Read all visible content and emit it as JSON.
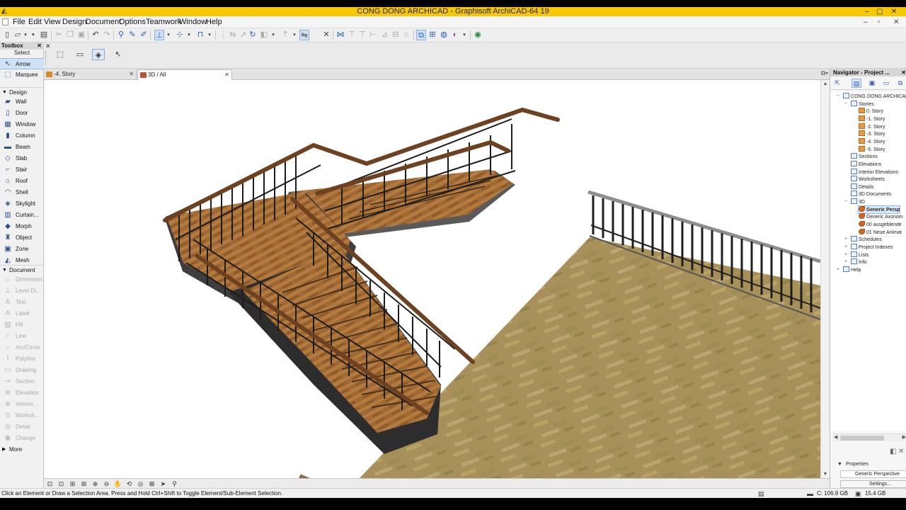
{
  "window": {
    "title": "CONG DONG ARCHICAD - Graphisoft ArchiCAD-64 19",
    "controls": [
      "–",
      "▢",
      "✕"
    ],
    "accent": "#f7c800"
  },
  "menu": [
    "File",
    "Edit",
    "View",
    "Design",
    "Document",
    "Options",
    "Teamwork",
    "Window",
    "Help"
  ],
  "toolbox": {
    "title": "Toolbox",
    "select_label": "Select",
    "select_tools": [
      {
        "label": "Arrow",
        "icon": "arrow-icon",
        "glyph": "↖",
        "active": true
      },
      {
        "label": "Marquee",
        "icon": "marquee-icon",
        "glyph": "⬚",
        "active": false
      }
    ],
    "design_label": "Design",
    "design_tools": [
      {
        "label": "Wall",
        "icon": "wall-icon",
        "glyph": "▰"
      },
      {
        "label": "Door",
        "icon": "door-icon",
        "glyph": "▯"
      },
      {
        "label": "Window",
        "icon": "window-icon",
        "glyph": "▦"
      },
      {
        "label": "Column",
        "icon": "column-icon",
        "glyph": "▮"
      },
      {
        "label": "Beam",
        "icon": "beam-icon",
        "glyph": "▬"
      },
      {
        "label": "Slab",
        "icon": "slab-icon",
        "glyph": "◇"
      },
      {
        "label": "Stair",
        "icon": "stair-icon",
        "glyph": "⌐"
      },
      {
        "label": "Roof",
        "icon": "roof-icon",
        "glyph": "⌂"
      },
      {
        "label": "Shell",
        "icon": "shell-icon",
        "glyph": "◠"
      },
      {
        "label": "Skylight",
        "icon": "skylight-icon",
        "glyph": "◈"
      },
      {
        "label": "Curtain...",
        "icon": "curtain-wall-icon",
        "glyph": "▥"
      },
      {
        "label": "Morph",
        "icon": "morph-icon",
        "glyph": "◆"
      },
      {
        "label": "Object",
        "icon": "object-icon",
        "glyph": "♜"
      },
      {
        "label": "Zone",
        "icon": "zone-icon",
        "glyph": "▣"
      },
      {
        "label": "Mesh",
        "icon": "mesh-icon",
        "glyph": "◭"
      }
    ],
    "document_label": "Document",
    "document_tools": [
      {
        "label": "Dimension",
        "icon": "dimension-icon",
        "glyph": "↔"
      },
      {
        "label": "Level Di...",
        "icon": "level-dimension-icon",
        "glyph": "⊥"
      },
      {
        "label": "Text",
        "icon": "text-icon",
        "glyph": "A"
      },
      {
        "label": "Label",
        "icon": "label-icon",
        "glyph": "A"
      },
      {
        "label": "Fill",
        "icon": "fill-icon",
        "glyph": "▨"
      },
      {
        "label": "Line",
        "icon": "line-icon",
        "glyph": "⁄"
      },
      {
        "label": "Arc/Circle",
        "icon": "arc-circle-icon",
        "glyph": "○"
      },
      {
        "label": "Polyline",
        "icon": "polyline-icon",
        "glyph": "⌇"
      },
      {
        "label": "Drawing",
        "icon": "drawing-icon",
        "glyph": "▭"
      },
      {
        "label": "Section",
        "icon": "section-icon",
        "glyph": "⊸"
      },
      {
        "label": "Elevation",
        "icon": "elevation-icon",
        "glyph": "⊕"
      },
      {
        "label": "Interior...",
        "icon": "interior-elevation-icon",
        "glyph": "⊗"
      },
      {
        "label": "Worksh...",
        "icon": "worksheet-icon",
        "glyph": "⊙"
      },
      {
        "label": "Detail",
        "icon": "detail-icon",
        "glyph": "◎"
      },
      {
        "label": "Change",
        "icon": "change-icon",
        "glyph": "◉"
      }
    ],
    "more_label": "More"
  },
  "tabs": [
    {
      "label": "-4. Story",
      "icon": "story-tab-icon",
      "active": false
    },
    {
      "label": "3D / All",
      "icon": "3d-tab-icon",
      "active": true
    }
  ],
  "status": {
    "message": "Click an Element or Draw a Selection Area. Press and Hold Ctrl+Shift to Toggle Element/Sub-Element Selection.",
    "disk": "C: 106.9 GB",
    "memory": "15.4 GB"
  },
  "navigator": {
    "title": "Navigator - Project ...",
    "tree": [
      {
        "label": "CONG DONG ARCHICAD",
        "level": 0,
        "icon": "project-icon",
        "expanded": true
      },
      {
        "label": "Stories",
        "level": 1,
        "icon": "stories-icon",
        "expanded": true
      },
      {
        "label": "0. Story",
        "level": 2,
        "icon": "story-icon"
      },
      {
        "label": "-1. Story",
        "level": 2,
        "icon": "story-icon"
      },
      {
        "label": "-2. Story",
        "level": 2,
        "icon": "story-icon"
      },
      {
        "label": "-3. Story",
        "level": 2,
        "icon": "story-icon"
      },
      {
        "label": "-4. Story",
        "level": 2,
        "icon": "story-icon"
      },
      {
        "label": "-5. Story",
        "level": 2,
        "icon": "story-icon"
      },
      {
        "label": "Sections",
        "level": 1,
        "icon": "sections-icon"
      },
      {
        "label": "Elevations",
        "level": 1,
        "icon": "elevations-icon"
      },
      {
        "label": "Interior Elevations",
        "level": 1,
        "icon": "interior-elevations-icon"
      },
      {
        "label": "Worksheets",
        "level": 1,
        "icon": "worksheets-icon"
      },
      {
        "label": "Details",
        "level": 1,
        "icon": "details-icon"
      },
      {
        "label": "3D Documents",
        "level": 1,
        "icon": "3d-documents-icon"
      },
      {
        "label": "3D",
        "level": 1,
        "icon": "3d-folder-icon",
        "expanded": true
      },
      {
        "label": "Generic Persp",
        "level": 2,
        "icon": "camera-icon",
        "selected": true
      },
      {
        "label": "Generic Axonom",
        "level": 2,
        "icon": "camera-icon"
      },
      {
        "label": "00 ausgeblende",
        "level": 2,
        "icon": "camera-icon"
      },
      {
        "label": "01 Neue Animat",
        "level": 2,
        "icon": "camera-icon"
      },
      {
        "label": "Schedules",
        "level": 1,
        "icon": "schedules-icon",
        "collapsed": true
      },
      {
        "label": "Project Indexes",
        "level": 1,
        "icon": "project-indexes-icon",
        "collapsed": true
      },
      {
        "label": "Lists",
        "level": 1,
        "icon": "lists-icon",
        "collapsed": true
      },
      {
        "label": "Info",
        "level": 1,
        "icon": "info-icon",
        "collapsed": true
      },
      {
        "label": "Help",
        "level": 0,
        "icon": "help-icon",
        "collapsed": true
      }
    ],
    "properties_label": "Properties",
    "properties_value": "Generic Perspective",
    "settings_label": "Settings..."
  },
  "scene": {
    "wood_color": "#8a5a2b",
    "floor_color": "#a88f52",
    "railing_color": "#222222"
  }
}
